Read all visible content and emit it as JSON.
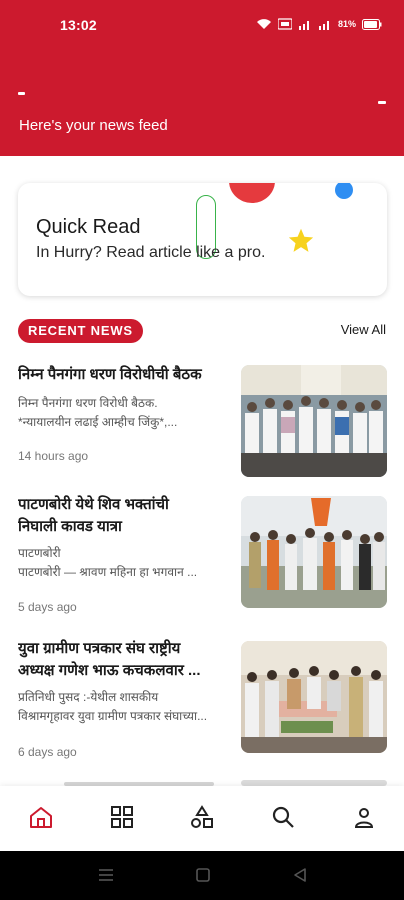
{
  "status_bar": {
    "time": "13:02",
    "battery": "81%"
  },
  "header": {
    "feed_title": "Here's your news feed"
  },
  "quick_read": {
    "title": "Quick Read",
    "subtitle": "In Hurry? Read article like a pro."
  },
  "recent_news": {
    "badge_label": "RECENT NEWS",
    "view_all_label": "View All",
    "items": [
      {
        "title": "निम्न पैनगंगा धरण विरोधीची बैठक",
        "excerpt_line1": "निम्न पैनगंगा धरण विरोधी बैठक.",
        "excerpt_line2": "*न्यायालयीन लढाई आम्हीच जिंकु*,...",
        "time": "14 hours ago"
      },
      {
        "title_line1": "पाटणबोरी येथे शिव भक्तांची",
        "title_line2": "निघाली कावड यात्रा",
        "excerpt_line1": "पाटणबोरी",
        "excerpt_line2": "पाटणबोरी — श्रावण महिना हा भगवान ...",
        "time": "5 days ago"
      },
      {
        "title_line1": "युवा ग्रामीण पत्रकार संघ राष्ट्रीय",
        "title_line2": "अध्यक्ष गणेश भाऊ कचकलवार ...",
        "excerpt_line1": "प्रतिनिधी पुसद :-येथील शासकीय",
        "excerpt_line2": "विश्रामगृहावर  युवा ग्रामीण पत्रकार संघाच्या...",
        "time": "6 days ago"
      }
    ]
  },
  "bottom_nav": {
    "items": [
      "home-icon",
      "categories-icon",
      "shapes-icon",
      "search-icon",
      "profile-icon"
    ],
    "active": "home-icon"
  },
  "colors": {
    "brand": "#cc1a2e",
    "accent_blue": "#2f8ef2",
    "accent_yellow": "#f7d21e",
    "accent_green": "#39b34a"
  }
}
